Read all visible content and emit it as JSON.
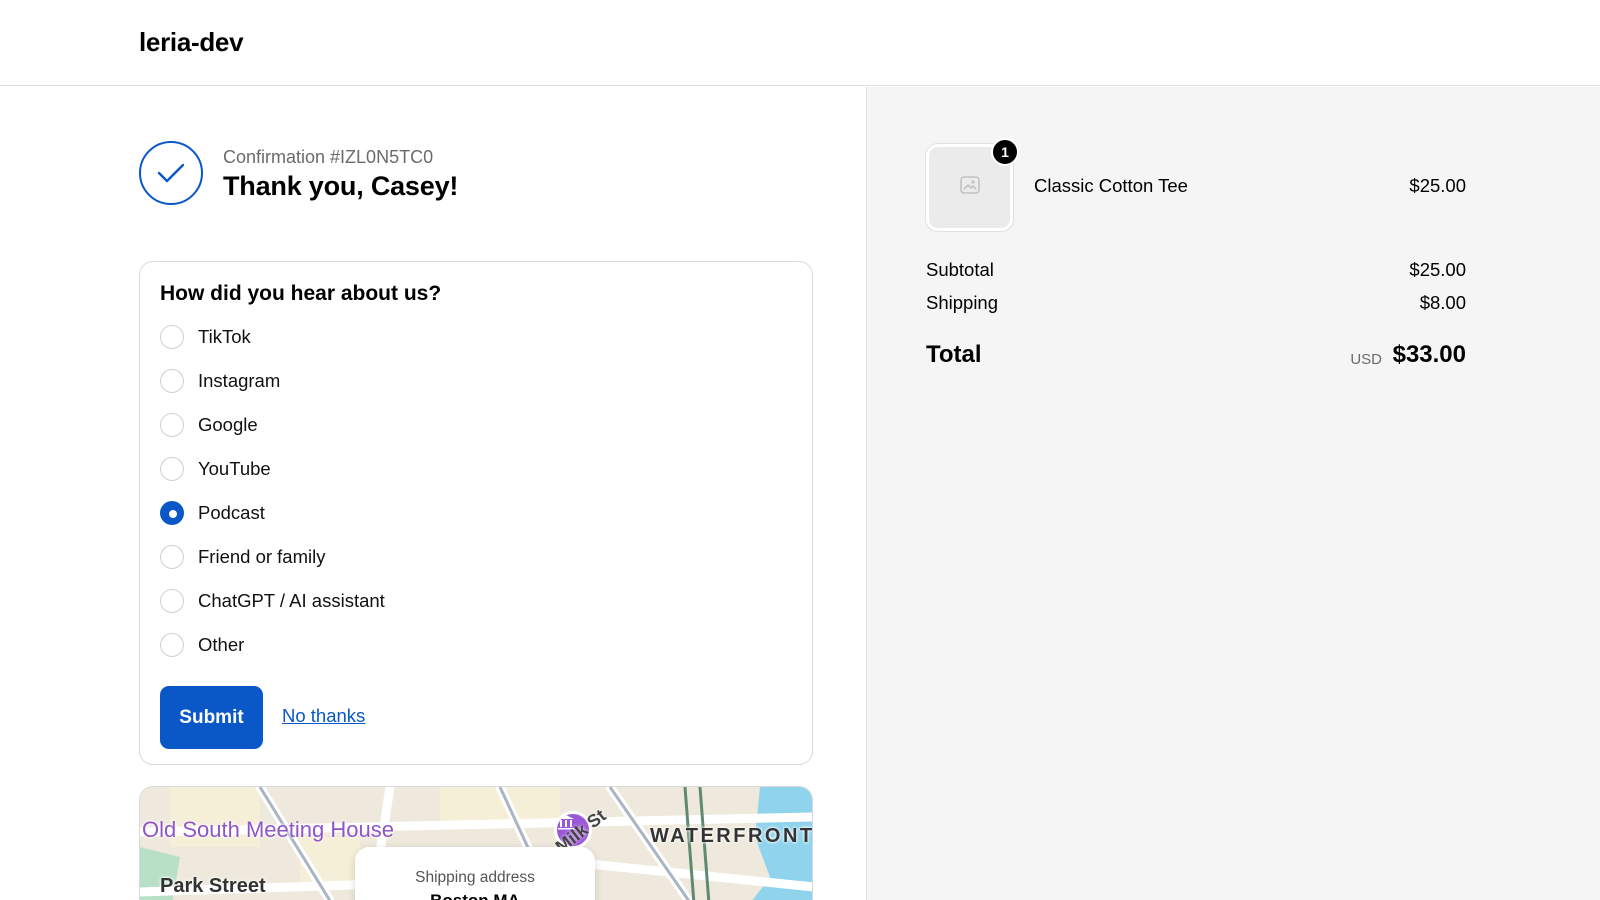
{
  "header": {
    "store_name": "leria-dev"
  },
  "confirmation": {
    "number_label": "Confirmation #IZL0N5TC0",
    "thank_you": "Thank you, Casey!"
  },
  "survey": {
    "question": "How did you hear about us?",
    "options": [
      {
        "label": "TikTok",
        "selected": false
      },
      {
        "label": "Instagram",
        "selected": false
      },
      {
        "label": "Google",
        "selected": false
      },
      {
        "label": "YouTube",
        "selected": false
      },
      {
        "label": "Podcast",
        "selected": true
      },
      {
        "label": "Friend or family",
        "selected": false
      },
      {
        "label": "ChatGPT / AI assistant",
        "selected": false
      },
      {
        "label": "Other",
        "selected": false
      }
    ],
    "submit_label": "Submit",
    "decline_label": "No thanks"
  },
  "map": {
    "poi_label": "Old South Meeting House",
    "station_label": "Park Street",
    "district_label": "WATERFRONT",
    "street_label": "Milk St",
    "shipping_title": "Shipping address",
    "shipping_city": "Boston MA"
  },
  "order": {
    "item": {
      "name": "Classic Cotton Tee",
      "price": "$25.00",
      "quantity": "1"
    },
    "subtotal_label": "Subtotal",
    "subtotal": "$25.00",
    "shipping_label": "Shipping",
    "shipping": "$8.00",
    "total_label": "Total",
    "currency": "USD",
    "total": "$33.00"
  },
  "colors": {
    "accent": "#0a57c7",
    "summary_bg": "#f5f5f5",
    "poi": "#9b57d8"
  }
}
